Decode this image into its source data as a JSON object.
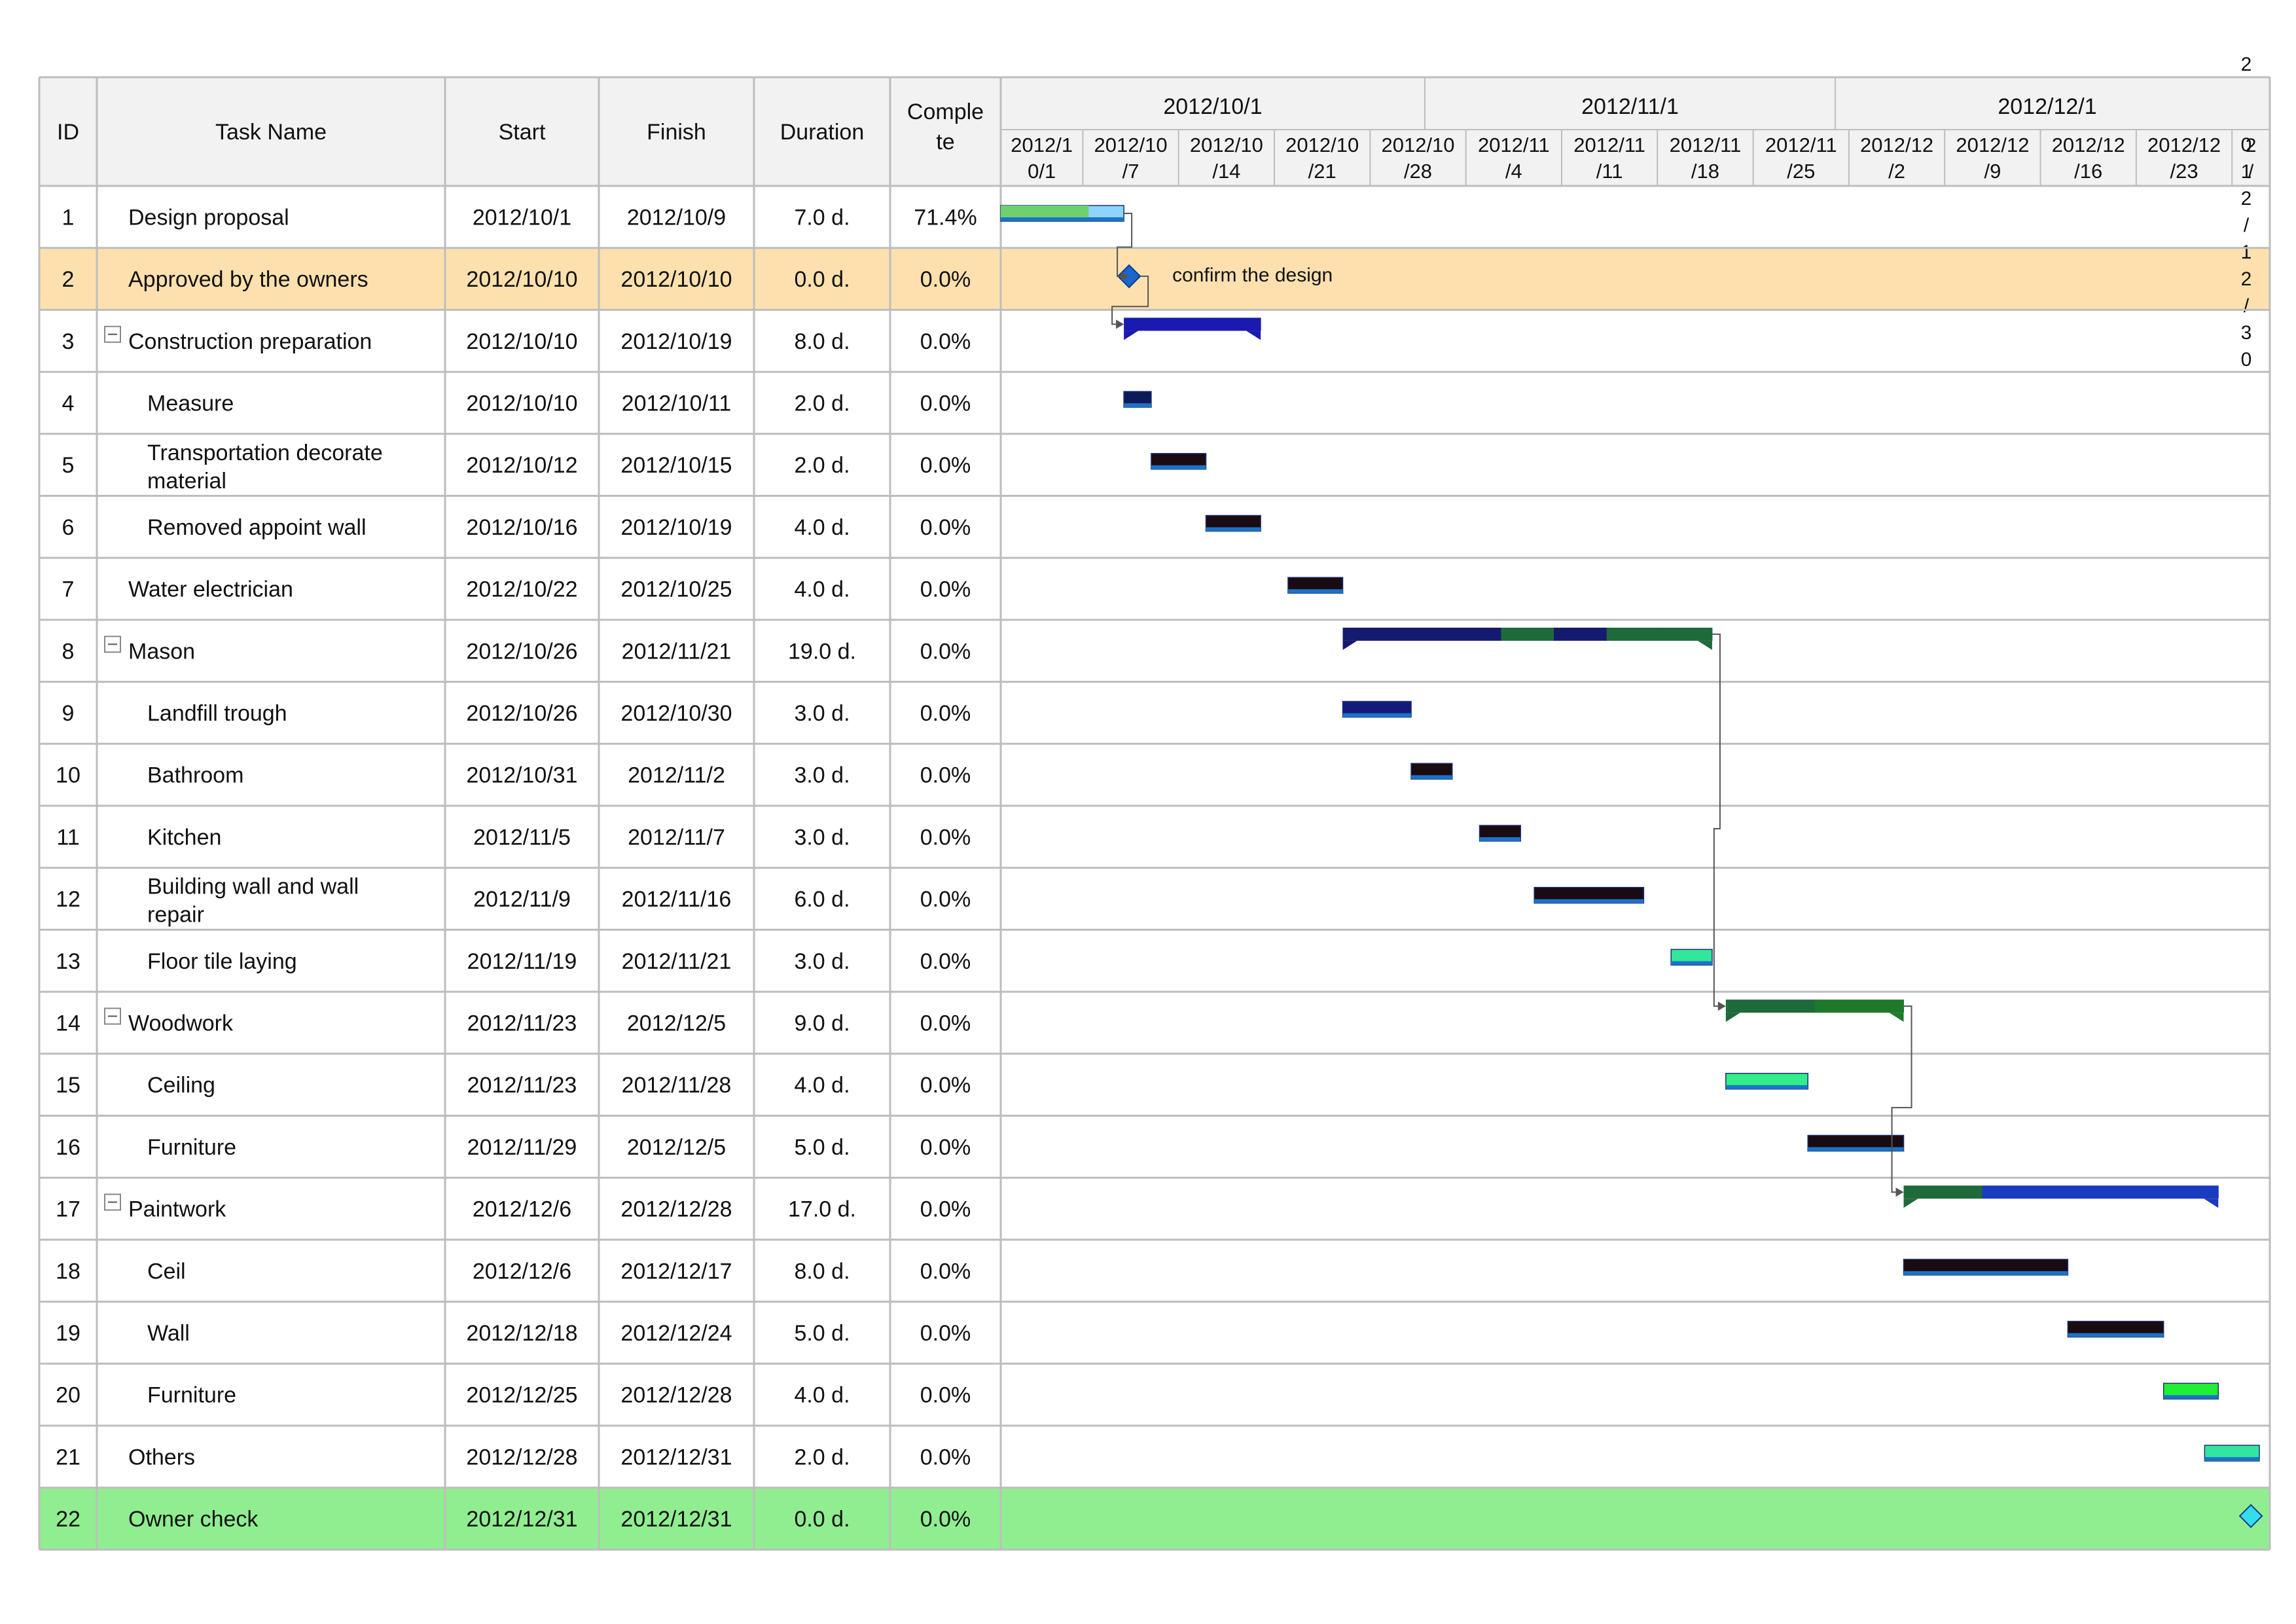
{
  "chart_data": {
    "type": "gantt",
    "columns": {
      "id": "ID",
      "task_name": "Task Name",
      "start": "Start",
      "finish": "Finish",
      "duration": "Duration",
      "complete_line1": "Comple",
      "complete_line2": "te"
    },
    "timeline": {
      "start": "2012-10-01",
      "end": "2012-12-31",
      "months": [
        {
          "label": "2012/10/1",
          "start": "2012-10-01"
        },
        {
          "label": "2012/11/1",
          "start": "2012-11-01"
        },
        {
          "label": "2012/12/1",
          "start": "2012-12-01"
        }
      ],
      "weeks": [
        {
          "start": "2012-10-01",
          "line1": "2012/1",
          "line2": "0/1"
        },
        {
          "start": "2012-10-07",
          "line1": "2012/10",
          "line2": "/7"
        },
        {
          "start": "2012-10-14",
          "line1": "2012/10",
          "line2": "/14"
        },
        {
          "start": "2012-10-21",
          "line1": "2012/10",
          "line2": "/21"
        },
        {
          "start": "2012-10-28",
          "line1": "2012/10",
          "line2": "/28"
        },
        {
          "start": "2012-11-04",
          "line1": "2012/11",
          "line2": "/4"
        },
        {
          "start": "2012-11-11",
          "line1": "2012/11",
          "line2": "/11"
        },
        {
          "start": "2012-11-18",
          "line1": "2012/11",
          "line2": "/18"
        },
        {
          "start": "2012-11-25",
          "line1": "2012/11",
          "line2": "/25"
        },
        {
          "start": "2012-12-02",
          "line1": "2012/12",
          "line2": "/2"
        },
        {
          "start": "2012-12-09",
          "line1": "2012/12",
          "line2": "/9"
        },
        {
          "start": "2012-12-16",
          "line1": "2012/12",
          "line2": "/16"
        },
        {
          "start": "2012-12-23",
          "line1": "2012/12",
          "line2": "/23"
        },
        {
          "start": "2012-12-30",
          "line1": "2",
          "line2": "/"
        }
      ],
      "vertical_label": "2012/12/30"
    },
    "tasks": [
      {
        "id": "1",
        "name": [
          "Design proposal"
        ],
        "start": "2012/10/1",
        "finish": "2012/10/9",
        "duration": "7.0 d.",
        "complete": "71.4%",
        "level": 0,
        "kind": "task",
        "bar_color": "#8fd4ff",
        "progress_color": "#6fd06f",
        "progress": 0.714
      },
      {
        "id": "2",
        "name": [
          "Approved by the owners"
        ],
        "start": "2012/10/10",
        "finish": "2012/10/10",
        "duration": "0.0 d.",
        "complete": "0.0%",
        "level": 0,
        "kind": "milestone",
        "row_color": "#fde0ae",
        "label": "confirm the design"
      },
      {
        "id": "3",
        "name": [
          "Construction preparation"
        ],
        "start": "2012/10/10",
        "finish": "2012/10/19",
        "duration": "8.0 d.",
        "complete": "0.0%",
        "level": 0,
        "kind": "summary",
        "collapse": "−"
      },
      {
        "id": "4",
        "name": [
          "Measure"
        ],
        "start": "2012/10/10",
        "finish": "2012/10/11",
        "duration": "2.0 d.",
        "complete": "0.0%",
        "level": 1,
        "kind": "task",
        "bar_color": "#0d1a5a"
      },
      {
        "id": "5",
        "name": [
          "Transportation decorate",
          "material"
        ],
        "start": "2012/10/12",
        "finish": "2012/10/15",
        "duration": "2.0 d.",
        "complete": "0.0%",
        "level": 1,
        "kind": "task",
        "bar_color": "#1a0a12"
      },
      {
        "id": "6",
        "name": [
          "Removed appoint wall"
        ],
        "start": "2012/10/16",
        "finish": "2012/10/19",
        "duration": "4.0 d.",
        "complete": "0.0%",
        "level": 1,
        "kind": "task",
        "bar_color": "#1a0a12"
      },
      {
        "id": "7",
        "name": [
          "Water electrician"
        ],
        "start": "2012/10/22",
        "finish": "2012/10/25",
        "duration": "4.0 d.",
        "complete": "0.0%",
        "level": 0,
        "kind": "task",
        "bar_color": "#1a0a12"
      },
      {
        "id": "8",
        "name": [
          "Mason"
        ],
        "start": "2012/10/26",
        "finish": "2012/11/21",
        "duration": "19.0 d.",
        "complete": "0.0%",
        "level": 0,
        "kind": "summary",
        "collapse": "−"
      },
      {
        "id": "9",
        "name": [
          "Landfill trough"
        ],
        "start": "2012/10/26",
        "finish": "2012/10/30",
        "duration": "3.0 d.",
        "complete": "0.0%",
        "level": 1,
        "kind": "task",
        "bar_color": "#131a7a"
      },
      {
        "id": "10",
        "name": [
          "Bathroom"
        ],
        "start": "2012/10/31",
        "finish": "2012/11/2",
        "duration": "3.0 d.",
        "complete": "0.0%",
        "level": 1,
        "kind": "task",
        "bar_color": "#1a0a12"
      },
      {
        "id": "11",
        "name": [
          "Kitchen"
        ],
        "start": "2012/11/5",
        "finish": "2012/11/7",
        "duration": "3.0 d.",
        "complete": "0.0%",
        "level": 1,
        "kind": "task",
        "bar_color": "#1a0a12"
      },
      {
        "id": "12",
        "name": [
          "Building wall and wall",
          "repair"
        ],
        "start": "2012/11/9",
        "finish": "2012/11/16",
        "duration": "6.0 d.",
        "complete": "0.0%",
        "level": 1,
        "kind": "task",
        "bar_color": "#1a0a12"
      },
      {
        "id": "13",
        "name": [
          "Floor tile laying"
        ],
        "start": "2012/11/19",
        "finish": "2012/11/21",
        "duration": "3.0 d.",
        "complete": "0.0%",
        "level": 1,
        "kind": "task",
        "bar_color": "#33e69a"
      },
      {
        "id": "14",
        "name": [
          "Woodwork"
        ],
        "start": "2012/11/23",
        "finish": "2012/12/5",
        "duration": "9.0 d.",
        "complete": "0.0%",
        "level": 0,
        "kind": "summary",
        "collapse": "−"
      },
      {
        "id": "15",
        "name": [
          "Ceiling"
        ],
        "start": "2012/11/23",
        "finish": "2012/11/28",
        "duration": "4.0 d.",
        "complete": "0.0%",
        "level": 1,
        "kind": "task",
        "bar_color": "#33ee88"
      },
      {
        "id": "16",
        "name": [
          "Furniture"
        ],
        "start": "2012/11/29",
        "finish": "2012/12/5",
        "duration": "5.0 d.",
        "complete": "0.0%",
        "level": 1,
        "kind": "task",
        "bar_color": "#1a0a12"
      },
      {
        "id": "17",
        "name": [
          "Paintwork"
        ],
        "start": "2012/12/6",
        "finish": "2012/12/28",
        "duration": "17.0 d.",
        "complete": "0.0%",
        "level": 0,
        "kind": "summary",
        "collapse": "−"
      },
      {
        "id": "18",
        "name": [
          "Ceil"
        ],
        "start": "2012/12/6",
        "finish": "2012/12/17",
        "duration": "8.0 d.",
        "complete": "0.0%",
        "level": 1,
        "kind": "task",
        "bar_color": "#1a0a12"
      },
      {
        "id": "19",
        "name": [
          "Wall"
        ],
        "start": "2012/12/18",
        "finish": "2012/12/24",
        "duration": "5.0 d.",
        "complete": "0.0%",
        "level": 1,
        "kind": "task",
        "bar_color": "#1a0a12"
      },
      {
        "id": "20",
        "name": [
          "Furniture"
        ],
        "start": "2012/12/25",
        "finish": "2012/12/28",
        "duration": "4.0 d.",
        "complete": "0.0%",
        "level": 1,
        "kind": "task",
        "bar_color": "#22ee33"
      },
      {
        "id": "21",
        "name": [
          "Others"
        ],
        "start": "2012/12/28",
        "finish": "2012/12/31",
        "duration": "2.0 d.",
        "complete": "0.0%",
        "level": 0,
        "kind": "task",
        "bar_color": "#33e6a0"
      },
      {
        "id": "22",
        "name": [
          "Owner check"
        ],
        "start": "2012/12/31",
        "finish": "2012/12/31",
        "duration": "0.0 d.",
        "complete": "0.0%",
        "level": 0,
        "kind": "milestone",
        "row_color": "#90ee90"
      }
    ],
    "summary_segments": {
      "3": [
        "#1a1ab0",
        "#1a1ab0",
        "#1a1ab0"
      ],
      "8": [
        "#141a6e",
        "#141a6e",
        "#141a6e",
        "#1e6a3a",
        "#141a6e",
        "#1e6a3a",
        "#1e6a3a"
      ],
      "14": [
        "#1e6a3a",
        "#1e7a2a"
      ],
      "17": [
        "#1e6a3a",
        "#1a3ac0",
        "#1a3ac0",
        "#1a3ac0"
      ]
    },
    "links": [
      {
        "from": "1",
        "to": "2"
      },
      {
        "from": "2",
        "to": "3"
      },
      {
        "from": "8",
        "to": "14"
      },
      {
        "from": "14",
        "to": "17"
      }
    ],
    "colors": {
      "header_bg": "#f2f2f2",
      "grid": "#bdbdbd",
      "bar_bottom": "#1a73c8",
      "milestone": "#1a66cc",
      "milestone_end": "#33ddee",
      "link": "#555555"
    }
  }
}
